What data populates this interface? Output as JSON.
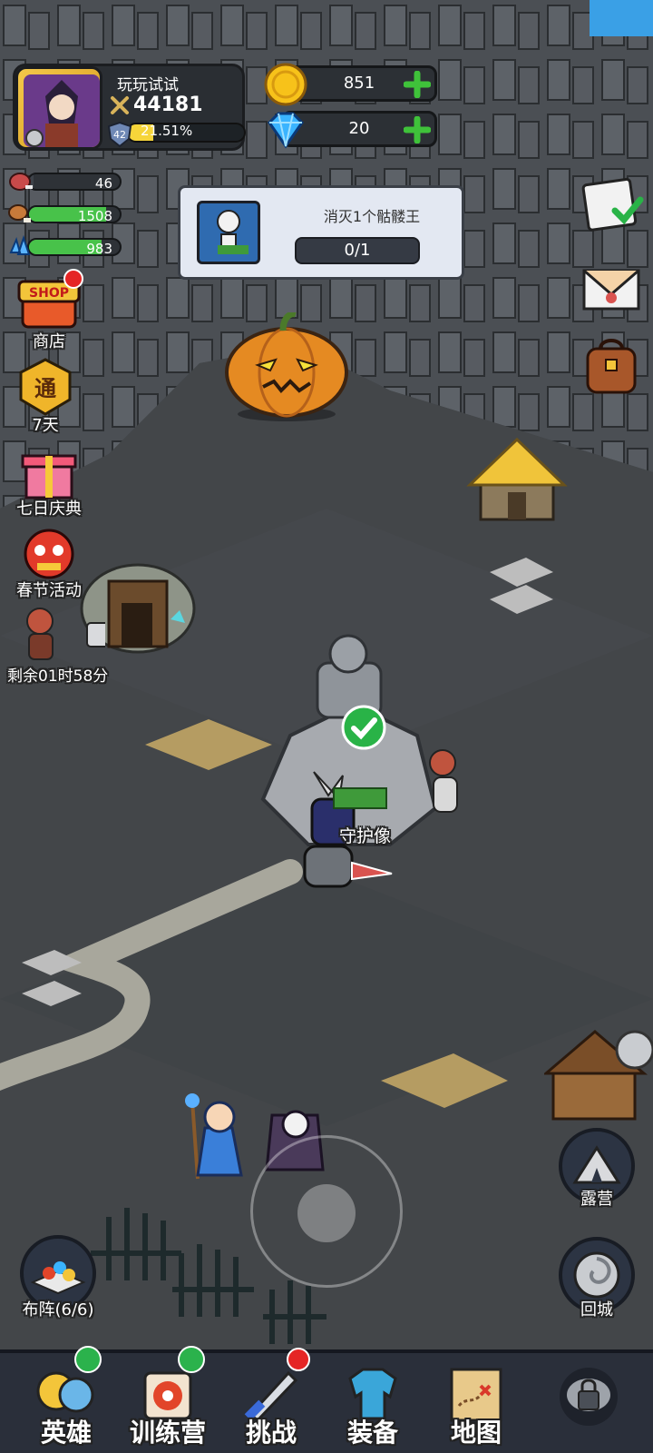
{
  "player": {
    "name": "玩玩试试",
    "power": "44181",
    "level": "42",
    "level_percent": "21.51%",
    "level_progress": 0.2151
  },
  "currency": {
    "gold": "851",
    "gems": "20"
  },
  "resources": [
    {
      "icon": "meat-icon",
      "value": "46",
      "fill": 0.05,
      "color": "#3e434a"
    },
    {
      "icon": "drumstick-icon",
      "value": "1508",
      "fill": 0.85,
      "color": "#48c24a"
    },
    {
      "icon": "crystal-icon",
      "value": "983",
      "fill": 0.8,
      "color": "#48c24a"
    }
  ],
  "quest": {
    "title": "消灭1个骷髅王",
    "progress": "0/1"
  },
  "side_menu": {
    "shop_badge": "SHOP",
    "shop": "商店",
    "pass_badge": "通",
    "pass": "7天",
    "celebration": "七日庆典",
    "festival": "春节活动",
    "timer": "剩余01时58分"
  },
  "map": {
    "statue_label": "守护像"
  },
  "buttons": {
    "formation": "布阵(6/6)",
    "camp": "露营",
    "return_city": "回城"
  },
  "nav": {
    "hero": "英雄",
    "training": "训练营",
    "challenge": "挑战",
    "equipment": "装备",
    "map": "地图"
  }
}
